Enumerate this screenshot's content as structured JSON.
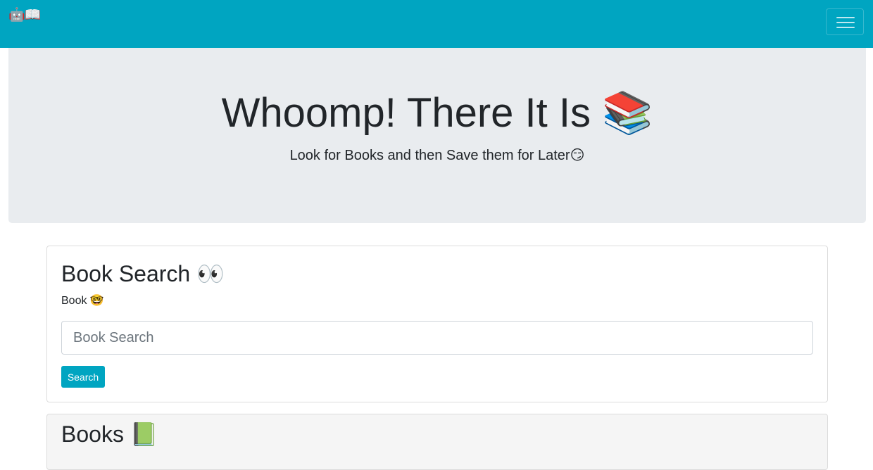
{
  "navbar": {
    "brand": "🤖📖",
    "toggle_icon": "hamburger-menu-icon",
    "background_color": "#00a5c1"
  },
  "hero": {
    "title": "Whoomp! There It Is 📚",
    "subtitle": "Look for Books and then Save them for Later😏",
    "background_color": "#e9ecef"
  },
  "search_card": {
    "title": "Book Search 👀",
    "label": "Book 🤓",
    "input_value": "",
    "input_placeholder": "Book Search",
    "button_label": "Search",
    "button_color": "#00a5c1"
  },
  "books_card": {
    "title": "Books 📗"
  }
}
